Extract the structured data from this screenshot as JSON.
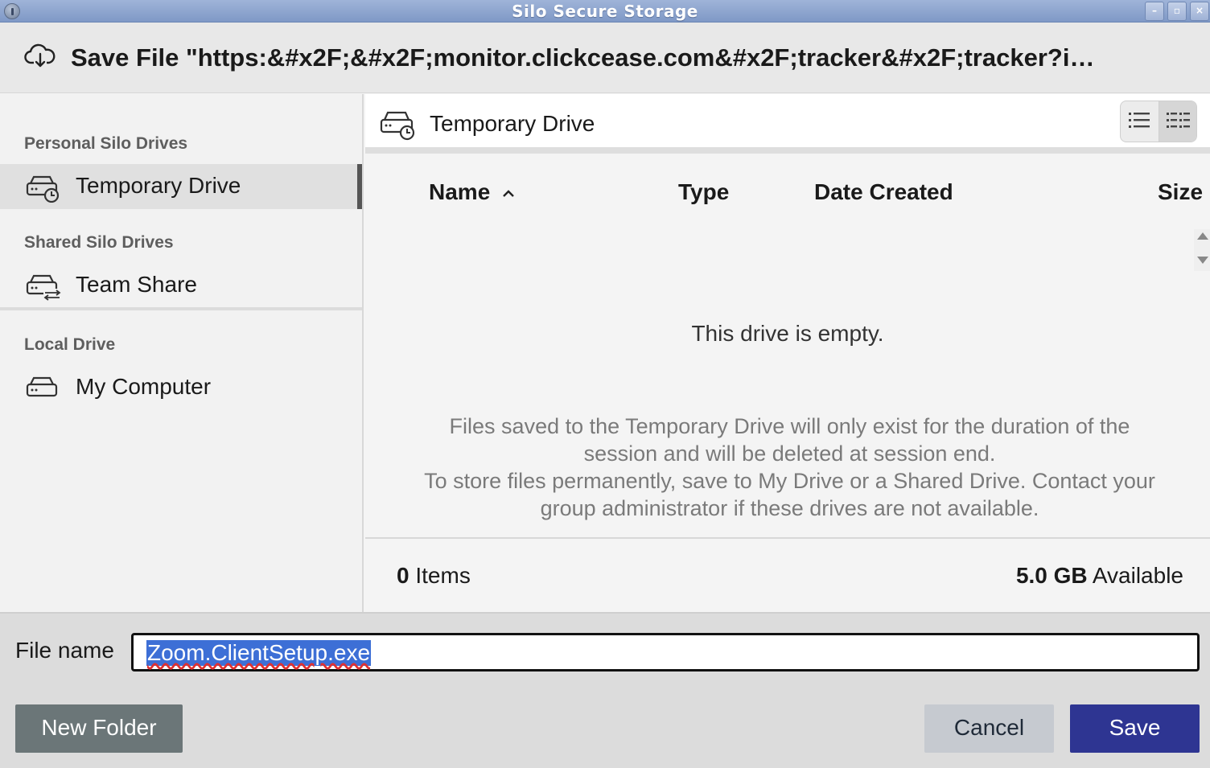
{
  "window": {
    "title": "Silo Secure Storage",
    "controls": {
      "minimize": "–",
      "maximize": "▫",
      "close": "×"
    }
  },
  "header": {
    "icon": "cloud-download-icon",
    "title": "Save File \"https:&#x2F;&#x2F;monitor.clickcease.com&#x2F;tracker&#x2F;tracker?i…"
  },
  "sidebar": {
    "sections": [
      {
        "label": "Personal Silo Drives",
        "items": [
          {
            "label": "Temporary Drive",
            "icon": "temporary-drive-icon",
            "active": true
          }
        ]
      },
      {
        "label": "Shared Silo Drives",
        "items": [
          {
            "label": "Team Share",
            "icon": "shared-drive-icon",
            "active": false
          }
        ]
      },
      {
        "label": "Local Drive",
        "items": [
          {
            "label": "My Computer",
            "icon": "local-drive-icon",
            "active": false
          }
        ]
      }
    ]
  },
  "main": {
    "drive_name": "Temporary Drive",
    "view_toggle": {
      "list": "list-view-icon",
      "grid": "detail-view-icon",
      "selected": "grid"
    },
    "columns": {
      "name": "Name",
      "type": "Type",
      "date_created": "Date Created",
      "size": "Size"
    },
    "sort_indicator": "^",
    "empty_title": "This drive is empty.",
    "empty_desc_line1": "Files saved to the Temporary Drive will only exist for the duration of the",
    "empty_desc_line2": "session and will be deleted at session end.",
    "empty_desc_line3": "To store files permanently, save to My Drive or a Shared Drive. Contact your",
    "empty_desc_line4": "group administrator if these drives are not available.",
    "item_count": "0",
    "items_label": " Items",
    "available_amount": "5.0 GB",
    "available_label": " Available"
  },
  "bottom": {
    "file_name_label": "File name",
    "file_name_value": "Zoom.ClientSetup.exe",
    "new_folder": "New Folder",
    "cancel": "Cancel",
    "save": "Save"
  },
  "colors": {
    "save_button": "#2e3592",
    "new_folder_button": "#6b7678",
    "selection": "#3d6fd6"
  }
}
